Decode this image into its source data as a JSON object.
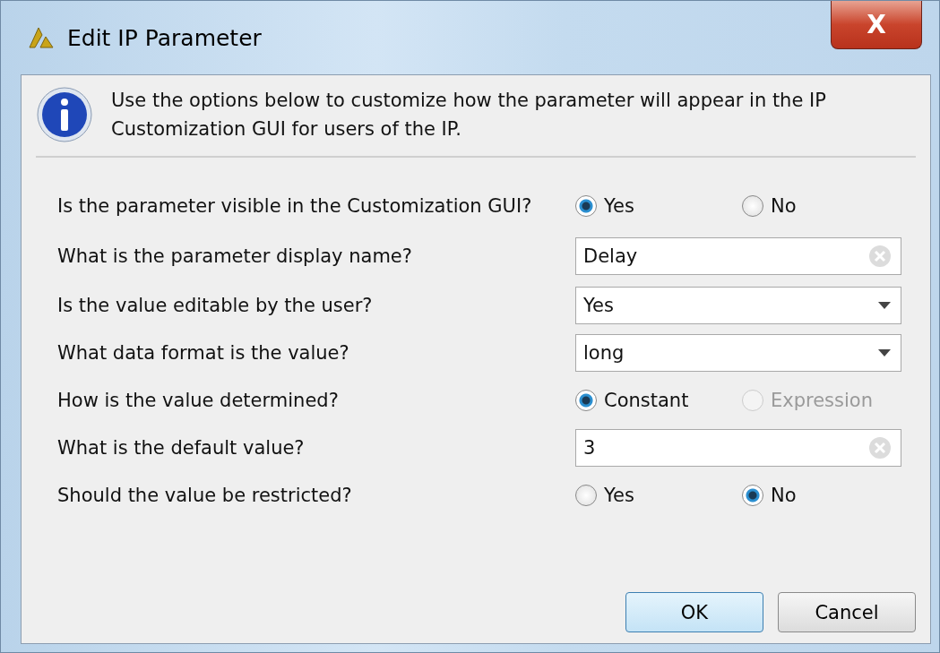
{
  "window": {
    "title": "Edit IP Parameter",
    "close": "X"
  },
  "info": "Use the options below to customize how the parameter will appear in the IP Customization GUI for users of the IP.",
  "rows": [
    {
      "label": "Is the parameter visible in the Customization GUI?",
      "kind": "radio",
      "options": [
        {
          "label": "Yes",
          "selected": true,
          "disabled": false
        },
        {
          "label": "No",
          "selected": false,
          "disabled": false
        }
      ]
    },
    {
      "label": "What is the parameter display name?",
      "kind": "text",
      "value": "Delay"
    },
    {
      "label": "Is the value editable by the user?",
      "kind": "select",
      "value": "Yes"
    },
    {
      "label": "What data format is the value?",
      "kind": "select",
      "value": "long"
    },
    {
      "label": "How is the value determined?",
      "kind": "radio",
      "options": [
        {
          "label": "Constant",
          "selected": true,
          "disabled": false
        },
        {
          "label": "Expression",
          "selected": false,
          "disabled": true
        }
      ]
    },
    {
      "label": "What is the default value?",
      "kind": "text",
      "value": "3"
    },
    {
      "label": "Should the value be restricted?",
      "kind": "radio",
      "options": [
        {
          "label": "Yes",
          "selected": false,
          "disabled": false
        },
        {
          "label": "No",
          "selected": true,
          "disabled": false
        }
      ]
    }
  ],
  "buttons": [
    {
      "label": "OK",
      "default": true
    },
    {
      "label": "Cancel",
      "default": false
    }
  ]
}
